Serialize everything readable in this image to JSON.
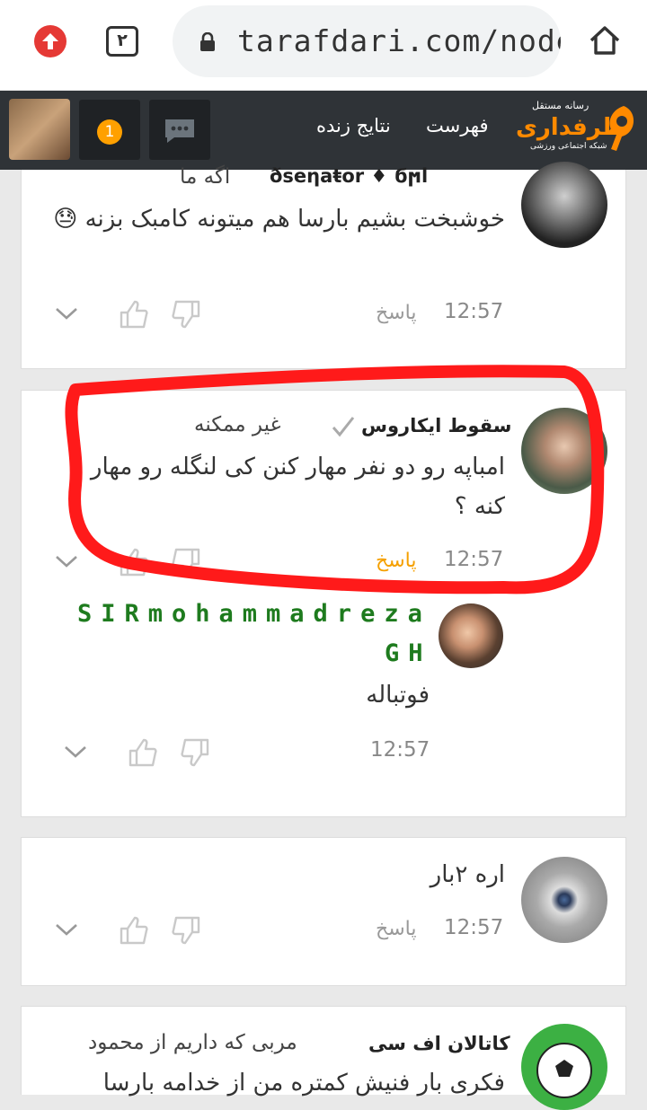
{
  "browser": {
    "tab_count": "۲",
    "url": "tarafdari.com/node/"
  },
  "header": {
    "logo_top": "رسانه مستقل",
    "logo_main": "طرفداری",
    "logo_sub": "شبکه اجتماعی ورزشی",
    "nav": [
      "فهرست",
      "نتایج زنده"
    ],
    "notification_count": "1"
  },
  "comments": [
    {
      "name_text": "ðseηaŧor ♦ ϭϻl",
      "subject": "اگه ما",
      "body": "خوشبخت بشیم بارسا هم میتونه کامبک بزنه 😓",
      "time": "12:57",
      "reply": "پاسخ"
    },
    {
      "name": "سقوط ایکاروس",
      "subject": "غیر ممکنه",
      "body": "امباپه رو دو نفر مهار کنن کی لنگله رو مهار کنه ؟",
      "time": "12:57",
      "reply": "پاسخ"
    },
    {
      "name_line1": "SIRmohammadreza",
      "name_line2": "GH",
      "body": "فوتباله",
      "time": "12:57"
    },
    {
      "body": "اره ۲بار",
      "time": "12:57",
      "reply": "پاسخ"
    },
    {
      "name": "کاتالان اف سی",
      "subject": "مربی که داریم از محمود",
      "body": "فکری بار فنیش کمتره من از خدامه بارسا"
    }
  ],
  "colors": {
    "accent": "#ff8a00",
    "reply_active": "#f5a000",
    "annotation": "#ff1a1a",
    "topbar": "#2f3337"
  }
}
